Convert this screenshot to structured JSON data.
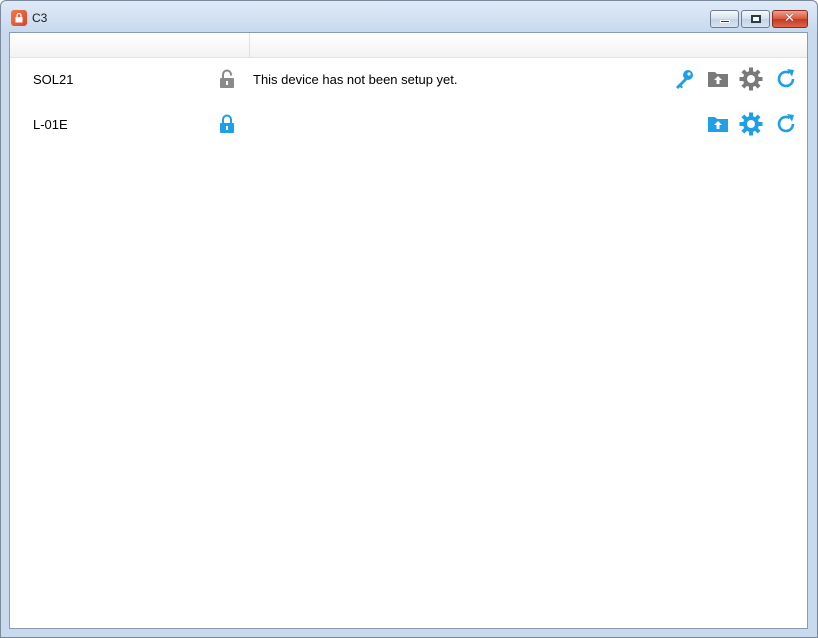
{
  "window": {
    "title": "C3",
    "controls": [
      "minimize",
      "maximize",
      "close"
    ]
  },
  "columns": [
    "",
    ""
  ],
  "devices": [
    {
      "name": "SOL21",
      "lock": "unlocked",
      "status": "This device has not been setup yet.",
      "actions": [
        "key-icon",
        "upload-folder-icon",
        "gear-icon",
        "refresh-icon"
      ],
      "colors": {
        "key": "#1e9fe6",
        "folder": "#7a7a7a",
        "gear": "#7a7a7a",
        "refresh": "#1e9fe6",
        "lock": "#8a8a8a"
      }
    },
    {
      "name": "L-01E",
      "lock": "locked",
      "status": "",
      "actions": [
        "upload-folder-icon",
        "gear-icon",
        "refresh-icon"
      ],
      "colors": {
        "folder": "#1e9fe6",
        "gear": "#1e9fe6",
        "refresh": "#1e9fe6",
        "lock": "#1e9fe6"
      }
    }
  ]
}
